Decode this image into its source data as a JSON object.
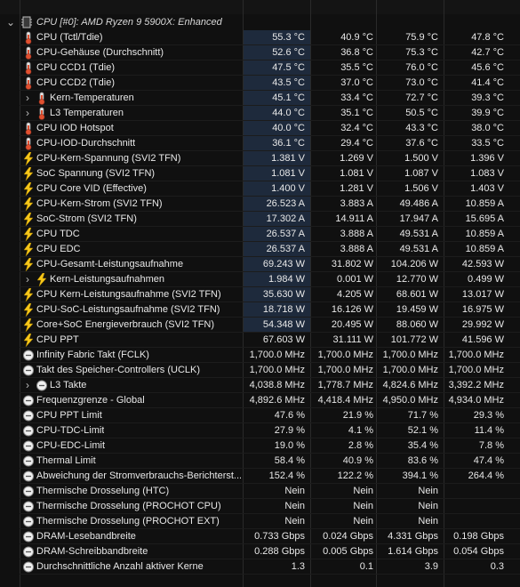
{
  "header": {
    "title": "CPU [#0]: AMD Ryzen 9 5900X: Enhanced",
    "expander": "chevron-down"
  },
  "colors": {
    "temp_icon": "#e05030",
    "bolt_icon": "#f6c619",
    "clock_icon": "#c8c8c8",
    "value_highlight": "#1e2a3c"
  },
  "rows": [
    {
      "label": "CPU (Tctl/Tdie)",
      "icon": "thermometer-icon",
      "v": [
        "55.3 °C",
        "40.9 °C",
        "75.9 °C",
        "47.8 °C"
      ]
    },
    {
      "label": "CPU-Gehäuse (Durchschnitt)",
      "icon": "thermometer-icon",
      "v": [
        "52.6 °C",
        "36.8 °C",
        "75.3 °C",
        "42.7 °C"
      ]
    },
    {
      "label": "CPU CCD1 (Tdie)",
      "icon": "thermometer-icon",
      "v": [
        "47.5 °C",
        "35.5 °C",
        "76.0 °C",
        "45.6 °C"
      ]
    },
    {
      "label": "CPU CCD2 (Tdie)",
      "icon": "thermometer-icon",
      "v": [
        "43.5 °C",
        "37.0 °C",
        "73.0 °C",
        "41.4 °C"
      ]
    },
    {
      "label": "Kern-Temperaturen",
      "icon": "thermometer-icon",
      "expandable": true,
      "v": [
        "45.1 °C",
        "33.4 °C",
        "72.7 °C",
        "39.3 °C"
      ]
    },
    {
      "label": "L3 Temperaturen",
      "icon": "thermometer-icon",
      "expandable": true,
      "v": [
        "44.0 °C",
        "35.1 °C",
        "50.5 °C",
        "39.9 °C"
      ]
    },
    {
      "label": "CPU IOD Hotspot",
      "icon": "thermometer-icon",
      "v": [
        "40.0 °C",
        "32.4 °C",
        "43.3 °C",
        "38.0 °C"
      ]
    },
    {
      "label": "CPU-IOD-Durchschnitt",
      "icon": "thermometer-icon",
      "v": [
        "36.1 °C",
        "29.4 °C",
        "37.6 °C",
        "33.5 °C"
      ]
    },
    {
      "label": "CPU-Kern-Spannung (SVI2 TFN)",
      "icon": "lightning-icon",
      "v": [
        "1.381 V",
        "1.269 V",
        "1.500 V",
        "1.396 V"
      ]
    },
    {
      "label": "SoC Spannung (SVI2 TFN)",
      "icon": "lightning-icon",
      "v": [
        "1.081 V",
        "1.081 V",
        "1.087 V",
        "1.083 V"
      ]
    },
    {
      "label": "CPU Core VID (Effective)",
      "icon": "lightning-icon",
      "v": [
        "1.400 V",
        "1.281 V",
        "1.506 V",
        "1.403 V"
      ]
    },
    {
      "label": "CPU-Kern-Strom (SVI2 TFN)",
      "icon": "lightning-icon",
      "v": [
        "26.523 A",
        "3.883 A",
        "49.486 A",
        "10.859 A"
      ]
    },
    {
      "label": "SoC-Strom (SVI2 TFN)",
      "icon": "lightning-icon",
      "v": [
        "17.302 A",
        "14.911 A",
        "17.947 A",
        "15.695 A"
      ]
    },
    {
      "label": "CPU TDC",
      "icon": "lightning-icon",
      "v": [
        "26.537 A",
        "3.888 A",
        "49.531 A",
        "10.859 A"
      ]
    },
    {
      "label": "CPU EDC",
      "icon": "lightning-icon",
      "v": [
        "26.537 A",
        "3.888 A",
        "49.531 A",
        "10.859 A"
      ]
    },
    {
      "label": "CPU-Gesamt-Leistungsaufnahme",
      "icon": "lightning-icon",
      "v": [
        "69.243 W",
        "31.802 W",
        "104.206 W",
        "42.593 W"
      ]
    },
    {
      "label": "Kern-Leistungsaufnahmen",
      "icon": "lightning-icon",
      "expandable": true,
      "v": [
        "1.984 W",
        "0.001 W",
        "12.770 W",
        "0.499 W"
      ]
    },
    {
      "label": "CPU Kern-Leistungsaufnahme (SVI2 TFN)",
      "icon": "lightning-icon",
      "v": [
        "35.630 W",
        "4.205 W",
        "68.601 W",
        "13.017 W"
      ]
    },
    {
      "label": "CPU-SoC-Leistungsaufnahme (SVI2 TFN)",
      "icon": "lightning-icon",
      "v": [
        "18.718 W",
        "16.126 W",
        "19.459 W",
        "16.975 W"
      ]
    },
    {
      "label": "Core+SoC Energieverbrauch (SVI2 TFN)",
      "icon": "lightning-icon",
      "v": [
        "54.348 W",
        "20.495 W",
        "88.060 W",
        "29.992 W"
      ]
    },
    {
      "label": "CPU PPT",
      "icon": "lightning-icon",
      "v": [
        "67.603 W",
        "31.111 W",
        "101.772 W",
        "41.596 W"
      ]
    },
    {
      "label": "Infinity Fabric Takt (FCLK)",
      "icon": "clock-icon",
      "v": [
        "1,700.0 MHz",
        "1,700.0 MHz",
        "1,700.0 MHz",
        "1,700.0 MHz"
      ]
    },
    {
      "label": "Takt des Speicher-Controllers (UCLK)",
      "icon": "clock-icon",
      "v": [
        "1,700.0 MHz",
        "1,700.0 MHz",
        "1,700.0 MHz",
        "1,700.0 MHz"
      ]
    },
    {
      "label": "L3 Takte",
      "icon": "clock-icon",
      "expandable": true,
      "v": [
        "4,038.8 MHz",
        "1,778.7 MHz",
        "4,824.6 MHz",
        "3,392.2 MHz"
      ]
    },
    {
      "label": "Frequenzgrenze - Global",
      "icon": "clock-icon",
      "v": [
        "4,892.6 MHz",
        "4,418.4 MHz",
        "4,950.0 MHz",
        "4,934.0 MHz"
      ]
    },
    {
      "label": "CPU PPT Limit",
      "icon": "clock-icon",
      "v": [
        "47.6 %",
        "21.9 %",
        "71.7 %",
        "29.3 %"
      ]
    },
    {
      "label": "CPU-TDC-Limit",
      "icon": "clock-icon",
      "v": [
        "27.9 %",
        "4.1 %",
        "52.1 %",
        "11.4 %"
      ]
    },
    {
      "label": "CPU-EDC-Limit",
      "icon": "clock-icon",
      "v": [
        "19.0 %",
        "2.8 %",
        "35.4 %",
        "7.8 %"
      ]
    },
    {
      "label": "Thermal Limit",
      "icon": "clock-icon",
      "v": [
        "58.4 %",
        "40.9 %",
        "83.6 %",
        "47.4 %"
      ]
    },
    {
      "label": "Abweichung der Stromverbrauchs-Berichterst...",
      "icon": "clock-icon",
      "v": [
        "152.4 %",
        "122.2 %",
        "394.1 %",
        "264.4 %"
      ]
    },
    {
      "label": "Thermische Drosselung (HTC)",
      "icon": "clock-icon",
      "v": [
        "Nein",
        "Nein",
        "Nein",
        ""
      ]
    },
    {
      "label": "Thermische Drosselung (PROCHOT CPU)",
      "icon": "clock-icon",
      "v": [
        "Nein",
        "Nein",
        "Nein",
        ""
      ]
    },
    {
      "label": "Thermische Drosselung (PROCHOT EXT)",
      "icon": "clock-icon",
      "v": [
        "Nein",
        "Nein",
        "Nein",
        ""
      ]
    },
    {
      "label": "DRAM-Lesebandbreite",
      "icon": "clock-icon",
      "v": [
        "0.733 Gbps",
        "0.024 Gbps",
        "4.331 Gbps",
        "0.198 Gbps"
      ]
    },
    {
      "label": "DRAM-Schreibbandbreite",
      "icon": "clock-icon",
      "v": [
        "0.288 Gbps",
        "0.005 Gbps",
        "1.614 Gbps",
        "0.054 Gbps"
      ]
    },
    {
      "label": "Durchschnittliche Anzahl aktiver Kerne",
      "icon": "clock-icon",
      "v": [
        "1.3",
        "0.1",
        "3.9",
        "0.3"
      ]
    }
  ]
}
